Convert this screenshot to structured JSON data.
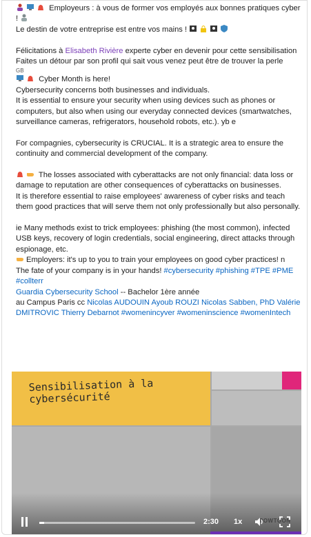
{
  "post": {
    "line1": "Employeurs : à vous de former vos employés aux bonnes pratiques cyber !",
    "line2": "Le destin de votre entreprise est entre vos mains !",
    "congrats_pre": "Félicitations à ",
    "congrats_name": "Elisabeth Rivière",
    "congrats_post": " experte cyber en devenir pour cette sensibilisation",
    "detour": "Faites un détour par son profil qui sait vous venez peut être de trouver la perle",
    "gb": "GB",
    "cyber_month": "Cyber Month is here!",
    "p1a": "Cybersecurity concerns both businesses and individuals.",
    "p1b": "It is essential to ensure your security when using devices such as phones or computers, but also when using our everyday connected devices (smartwatches, surveillance cameras, refrigerators, household robots, etc.). yb e",
    "p2": "For compagnies, cybersecurity is CRUCIAL. It is a strategic area to ensure the continuity and commercial development of the company.",
    "p3a": "The losses associated with cyberattacks are not only financial: data loss or damage to reputation are other consequences of cyberattacks on businesses.",
    "p3b": "It is therefore essential to raise employees' awareness of cyber risks and teach them good practices that will serve them not only professionally but also personally.",
    "p4a": "ie Many methods exist to trick employees: phishing (the most common), infected USB keys, recovery of login credentials, social engineering, direct attacks through espionage, etc.",
    "p4b": "Employers: it's up to you to train your employees on good cyber practices! n",
    "p4c": "The fate of your company is in your hands! ",
    "tag1": "#cybersecurity",
    "tag2": "#phishing",
    "tag3": "#TPE",
    "tag4": "#PME",
    "tag5": "#collterr",
    "school": "Guardia Cybersecurity School",
    "school_post": " -- Bachelor 1ère année",
    "campus_pre": "au Campus Paris cc ",
    "m1": "Nicolas AUDOUIN",
    "m2": "Ayoub ROUZI",
    "m3": "Nicolas Sabben, PhD",
    "m4": "Valérie DMITROVIC",
    "m5": "Thierry Debarnot",
    "tag6": "#womenincyver",
    "tag7": "#womeninscience",
    "tag8": "#womenIntech"
  },
  "video": {
    "title": "Sensibilisation à la\ncybersécurité",
    "time": "2:30",
    "speed": "1x",
    "watermark": "POWTOON",
    "progress": 0.03
  },
  "colors": {
    "link": "#0a66c2",
    "mention": "#7b3fb8",
    "yellow": "#f1bf46",
    "pink": "#e0267a"
  }
}
